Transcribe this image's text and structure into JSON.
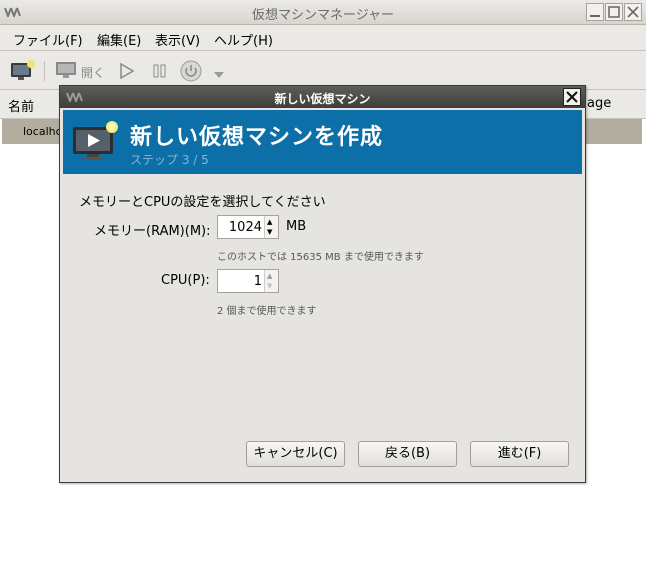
{
  "main_window": {
    "title": "仮想マシンマネージャー",
    "menu": [
      "ファイル(F)",
      "編集(E)",
      "表示(V)",
      "ヘルプ(H)"
    ],
    "toolbar": {
      "open_label": "開く"
    },
    "list": {
      "col_name": "名前",
      "col_usage_fragment": "age",
      "row_name_fragment": "localhc"
    }
  },
  "dialog": {
    "title": "新しい仮想マシン",
    "heading": "新しい仮想マシンを作成",
    "step": "ステップ 3 / 5",
    "section_label": "メモリーとCPUの設定を選択してください",
    "memory": {
      "label": "メモリー(RAM)(M):",
      "value": "1024",
      "unit": "MB",
      "hint": "このホストでは 15635 MB まで使用できます"
    },
    "cpu": {
      "label": "CPU(P):",
      "value": "1",
      "hint": "2 個まで使用できます"
    },
    "buttons": {
      "cancel": "キャンセル(C)",
      "back": "戻る(B)",
      "forward": "進む(F)"
    }
  },
  "colors": {
    "banner": "#0c6fa8",
    "selection": "#b3ad9f",
    "dialog_title": "#4a4947"
  }
}
